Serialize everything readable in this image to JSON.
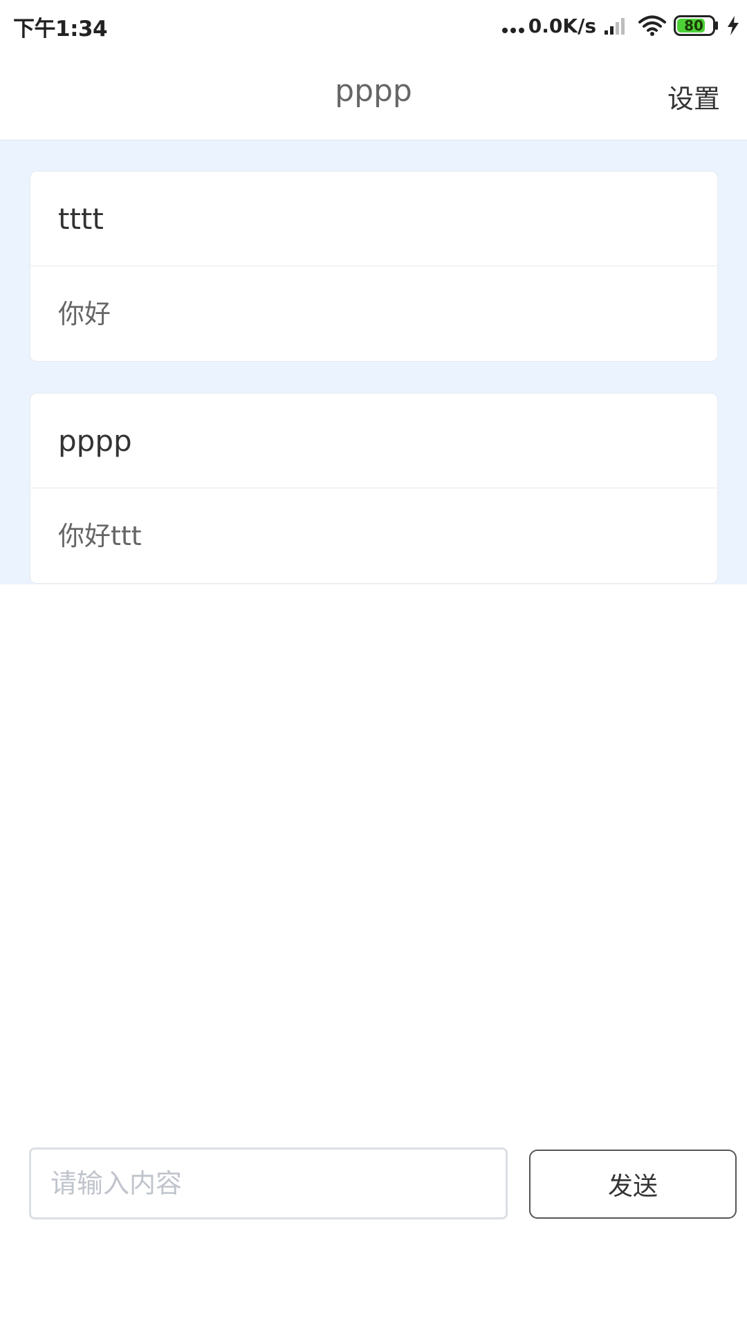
{
  "status_bar": {
    "time": "下午1:34",
    "net_speed": "0.0K/s",
    "battery_level": "80",
    "battery_color": "#4cd137"
  },
  "header": {
    "title": "pppp",
    "settings_label": "设置"
  },
  "colors": {
    "message_area_background": "#ebf3fe",
    "card_background": "#ffffff"
  },
  "messages": [
    {
      "sender": "tttt",
      "text": "你好"
    },
    {
      "sender": "pppp",
      "text": "你好ttt"
    }
  ],
  "composer": {
    "placeholder": "请输入内容",
    "value": "",
    "send_label": "发送"
  }
}
